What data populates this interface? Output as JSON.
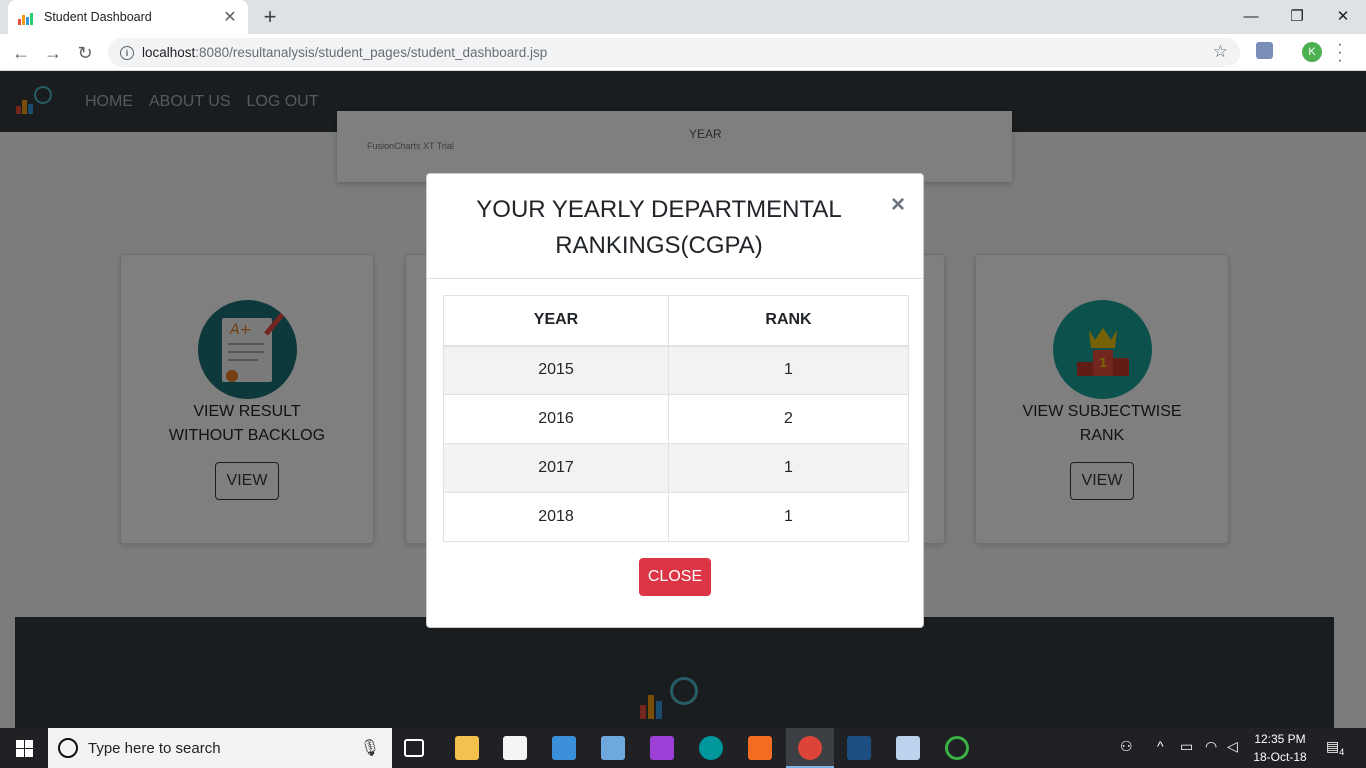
{
  "browser": {
    "tab_title": "Student Dashboard",
    "url_host": "localhost",
    "url_path": ":8080/resultanalysis/student_pages/student_dashboard.jsp",
    "profile_initial": "K"
  },
  "site_nav": {
    "links": [
      "HOME",
      "ABOUT US",
      "LOG OUT"
    ]
  },
  "chart_card": {
    "xlabel": "YEAR",
    "credit": "FusionCharts XT Trial"
  },
  "cards": [
    {
      "title_line1": "VIEW RESULT",
      "title_line2": "WITHOUT BACKLOG",
      "button": "VIEW"
    },
    {
      "title_line1": "VIEW SUBJECTWISE",
      "title_line2": "RANK",
      "button": "VIEW"
    }
  ],
  "modal": {
    "title": "YOUR YEARLY DEPARTMENTAL RANKINGS(CGPA)",
    "close_symbol": "×",
    "headers": [
      "YEAR",
      "RANK"
    ],
    "rows": [
      {
        "year": "2015",
        "rank": "1"
      },
      {
        "year": "2016",
        "rank": "2"
      },
      {
        "year": "2017",
        "rank": "1"
      },
      {
        "year": "2018",
        "rank": "1"
      }
    ],
    "close_button": "CLOSE"
  },
  "taskbar": {
    "search_placeholder": "Type here to search",
    "time": "12:35 PM",
    "date": "18-Oct-18",
    "notification_count": "4"
  },
  "colors": {
    "navbar": "#343a40",
    "danger": "#dc3545",
    "card_circle": "#1b7379"
  }
}
